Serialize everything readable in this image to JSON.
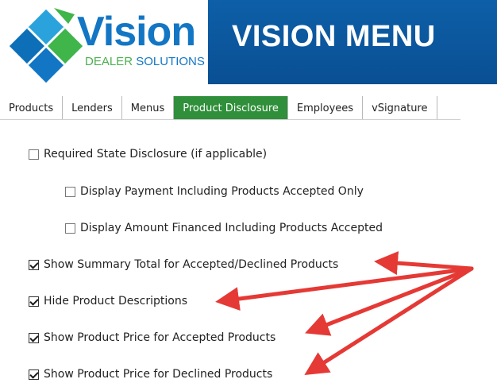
{
  "logo": {
    "word": "Vision",
    "sub_green": "DEALER",
    "sub_blue": "SOLUTIONS"
  },
  "banner": {
    "title": "VISION MENU"
  },
  "tabs": [
    {
      "label": "Products",
      "active": false
    },
    {
      "label": "Lenders",
      "active": false
    },
    {
      "label": "Menus",
      "active": false
    },
    {
      "label": "Product Disclosure",
      "active": true
    },
    {
      "label": "Employees",
      "active": false
    },
    {
      "label": "vSignature",
      "active": false
    }
  ],
  "options": [
    {
      "label": "Required State Disclosure (if applicable)",
      "checked": false
    },
    {
      "label": "Display Payment Including Products Accepted Only",
      "checked": false
    },
    {
      "label": "Display Amount Financed Including Products Accepted",
      "checked": false
    },
    {
      "label": "Show Summary Total for Accepted/Declined Products",
      "checked": true
    },
    {
      "label": "Hide Product Descriptions",
      "checked": true
    },
    {
      "label": "Show Product Price for Accepted Products",
      "checked": true
    },
    {
      "label": "Show Product Price for Declined Products",
      "checked": true
    }
  ],
  "colors": {
    "banner_blue": "#0d5fa8",
    "active_tab_green": "#2f8f3a",
    "arrow_red": "#e53935"
  }
}
